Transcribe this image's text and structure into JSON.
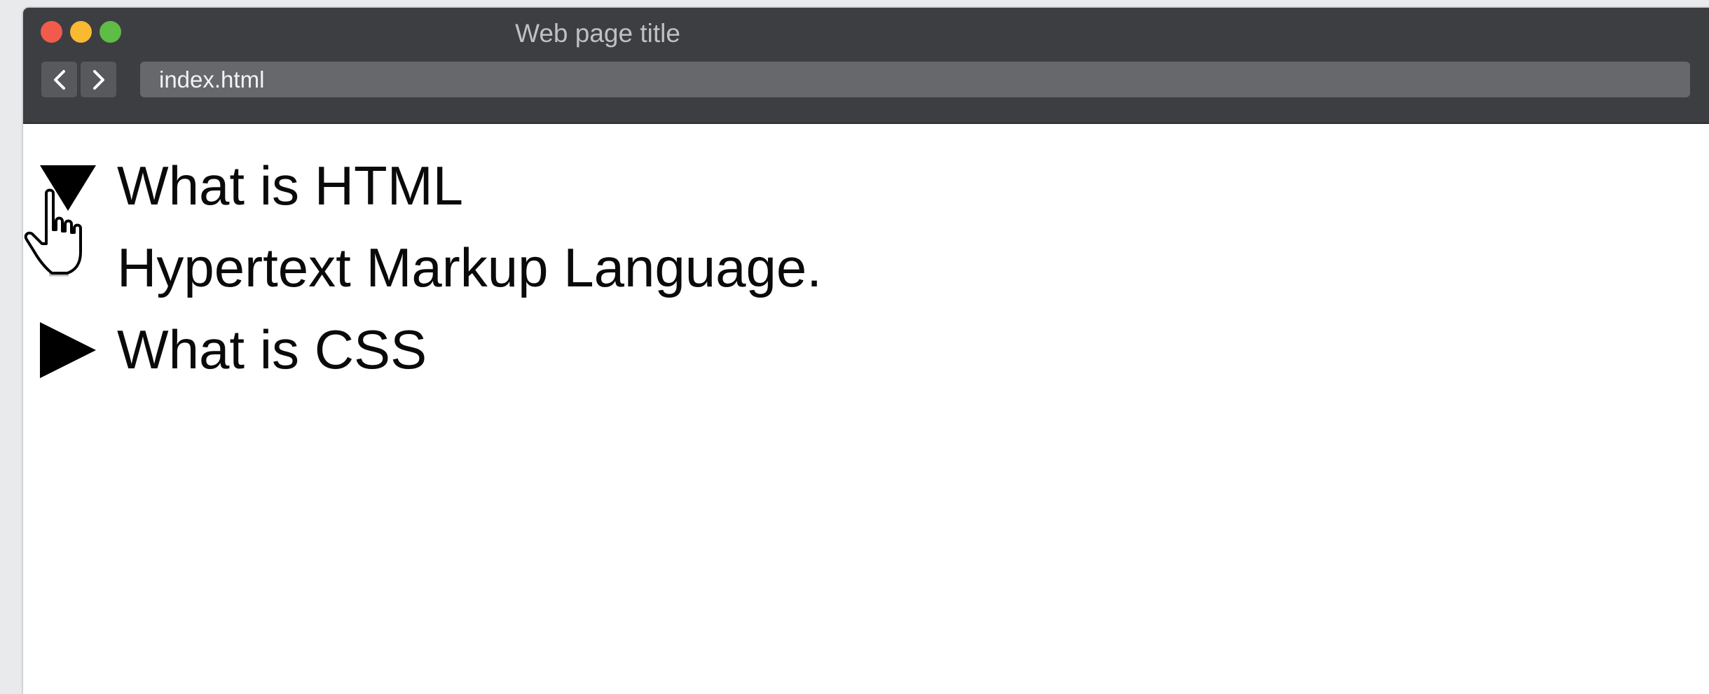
{
  "window": {
    "title": "Web page title",
    "traffic_lights": {
      "close": "#f25b4c",
      "minimize": "#f9b931",
      "maximize": "#5fbc45"
    }
  },
  "toolbar": {
    "back_icon": "chevron-left-icon",
    "forward_icon": "chevron-right-icon",
    "address": "index.html"
  },
  "content": {
    "details": [
      {
        "summary": "What is HTML",
        "open": true,
        "body": "Hypertext Markup Language."
      },
      {
        "summary": "What is CSS",
        "open": false
      }
    ]
  },
  "cursor": {
    "icon": "hand-pointer-icon"
  }
}
